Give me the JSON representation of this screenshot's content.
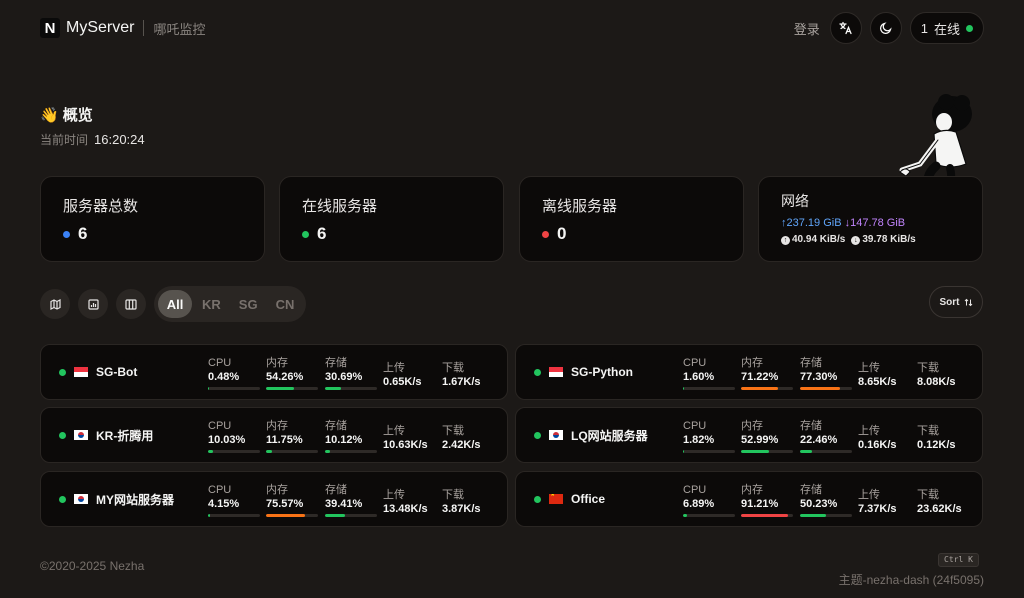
{
  "header": {
    "logo_letter": "N",
    "app_name": "MyServer",
    "subtitle": "哪吒监控",
    "login_label": "登录",
    "online_count": "1",
    "online_label": "在线"
  },
  "overview": {
    "emoji": "👋",
    "title": "概览",
    "time_label": "当前时间",
    "time_value": "16:20:24"
  },
  "stats": [
    {
      "label": "服务器总数",
      "value": "6",
      "dot_color": "#3b82f6"
    },
    {
      "label": "在线服务器",
      "value": "6",
      "dot_color": "#22c55e"
    },
    {
      "label": "离线服务器",
      "value": "0",
      "dot_color": "#ef4444"
    }
  ],
  "network": {
    "label": "网络",
    "upload_total": "↑237.19 GiB",
    "download_total": "↓147.78 GiB",
    "upload_speed": "40.94 KiB/s",
    "download_speed": "39.78 KiB/s"
  },
  "filters": {
    "tabs": [
      "All",
      "KR",
      "SG",
      "CN"
    ],
    "active_tab": "All",
    "sort_label": "Sort"
  },
  "metric_labels": {
    "cpu": "CPU",
    "mem": "内存",
    "disk": "存储",
    "up": "上传",
    "down": "下载"
  },
  "servers": [
    {
      "name": "SG-Bot",
      "flag": "SG",
      "cpu": "0.48%",
      "cpu_pct": 0.48,
      "mem": "54.26%",
      "mem_pct": 54.26,
      "disk": "30.69%",
      "disk_pct": 30.69,
      "up": "0.65K/s",
      "down": "1.67K/s"
    },
    {
      "name": "SG-Python",
      "flag": "SG",
      "cpu": "1.60%",
      "cpu_pct": 1.6,
      "mem": "71.22%",
      "mem_pct": 71.22,
      "disk": "77.30%",
      "disk_pct": 77.3,
      "up": "8.65K/s",
      "down": "8.08K/s"
    },
    {
      "name": "KR-折腾用",
      "flag": "KR",
      "cpu": "10.03%",
      "cpu_pct": 10.03,
      "mem": "11.75%",
      "mem_pct": 11.75,
      "disk": "10.12%",
      "disk_pct": 10.12,
      "up": "10.63K/s",
      "down": "2.42K/s"
    },
    {
      "name": "LQ网站服务器",
      "flag": "KR",
      "cpu": "1.82%",
      "cpu_pct": 1.82,
      "mem": "52.99%",
      "mem_pct": 52.99,
      "disk": "22.46%",
      "disk_pct": 22.46,
      "up": "0.16K/s",
      "down": "0.12K/s"
    },
    {
      "name": "MY网站服务器",
      "flag": "KR",
      "cpu": "4.15%",
      "cpu_pct": 4.15,
      "mem": "75.57%",
      "mem_pct": 75.57,
      "disk": "39.41%",
      "disk_pct": 39.41,
      "up": "13.48K/s",
      "down": "3.87K/s"
    },
    {
      "name": "Office",
      "flag": "CN",
      "cpu": "6.89%",
      "cpu_pct": 6.89,
      "mem": "91.21%",
      "mem_pct": 91.21,
      "disk": "50.23%",
      "disk_pct": 50.23,
      "up": "7.37K/s",
      "down": "23.62K/s"
    }
  ],
  "colors": {
    "ok": "#22c55e",
    "warn": "#f97316",
    "danger": "#ef4444"
  },
  "footer": {
    "copyright": "©2020-2025 Nezha",
    "shortcut": "Ctrl K",
    "theme": "主题-nezha-dash (24f5095)"
  }
}
